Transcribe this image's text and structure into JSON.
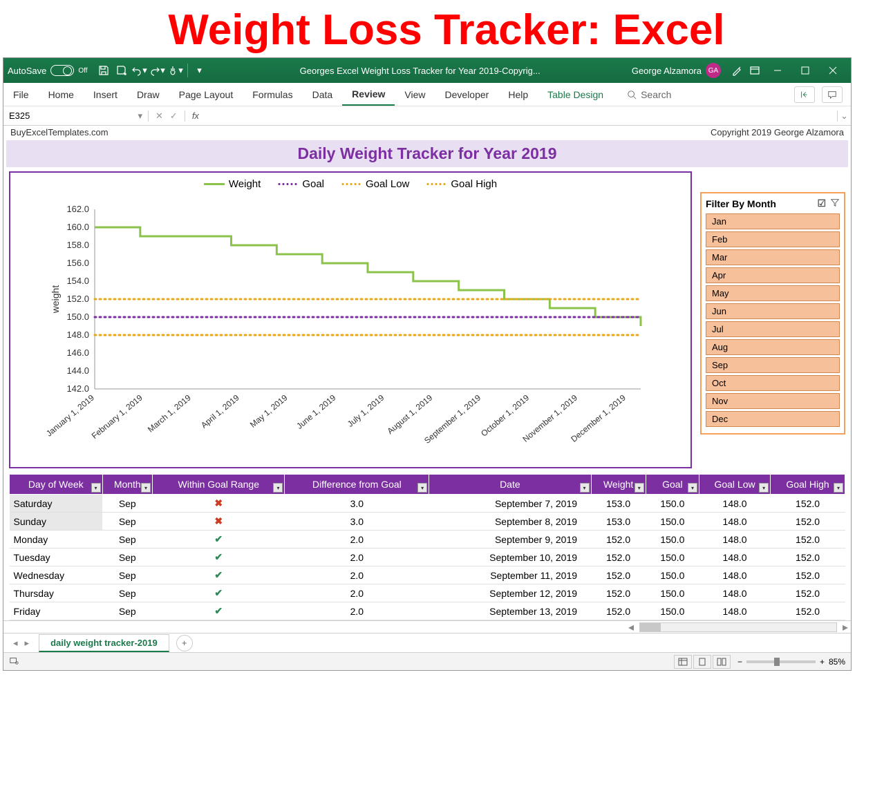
{
  "overlay_title": "Weight Loss Tracker: Excel",
  "titlebar": {
    "autosave_label": "AutoSave",
    "autosave_state": "Off",
    "doc_title": "Georges Excel Weight Loss Tracker for Year 2019-Copyrig...",
    "user": "George Alzamora",
    "avatar": "GA"
  },
  "ribbon": {
    "tabs": [
      "File",
      "Home",
      "Insert",
      "Draw",
      "Page Layout",
      "Formulas",
      "Data",
      "Review",
      "View",
      "Developer",
      "Help",
      "Table Design"
    ],
    "active": "Review",
    "search_label": "Search"
  },
  "formula_bar": {
    "name_box": "E325",
    "fx": "fx"
  },
  "sheet_header": {
    "left": "BuyExcelTemplates.com",
    "right": "Copyright 2019  George Alzamora"
  },
  "tracker_title": "Daily Weight Tracker for Year 2019",
  "legend": {
    "weight": "Weight",
    "goal": "Goal",
    "goal_low": "Goal Low",
    "goal_high": "Goal High"
  },
  "slicer": {
    "title": "Filter By Month",
    "items": [
      "Jan",
      "Feb",
      "Mar",
      "Apr",
      "May",
      "Jun",
      "Jul",
      "Aug",
      "Sep",
      "Oct",
      "Nov",
      "Dec"
    ]
  },
  "table": {
    "headers": [
      "Day of Week",
      "Month",
      "Within Goal Range",
      "Difference from Goal",
      "Date",
      "Weight",
      "Goal",
      "Goal Low",
      "Goal High"
    ],
    "rows": [
      {
        "dow": "Saturday",
        "month": "Sep",
        "within": false,
        "diff": "3.0",
        "date": "September 7, 2019",
        "weight": "153.0",
        "goal": "150.0",
        "low": "148.0",
        "high": "152.0"
      },
      {
        "dow": "Sunday",
        "month": "Sep",
        "within": false,
        "diff": "3.0",
        "date": "September 8, 2019",
        "weight": "153.0",
        "goal": "150.0",
        "low": "148.0",
        "high": "152.0"
      },
      {
        "dow": "Monday",
        "month": "Sep",
        "within": true,
        "diff": "2.0",
        "date": "September 9, 2019",
        "weight": "152.0",
        "goal": "150.0",
        "low": "148.0",
        "high": "152.0"
      },
      {
        "dow": "Tuesday",
        "month": "Sep",
        "within": true,
        "diff": "2.0",
        "date": "September 10, 2019",
        "weight": "152.0",
        "goal": "150.0",
        "low": "148.0",
        "high": "152.0"
      },
      {
        "dow": "Wednesday",
        "month": "Sep",
        "within": true,
        "diff": "2.0",
        "date": "September 11, 2019",
        "weight": "152.0",
        "goal": "150.0",
        "low": "148.0",
        "high": "152.0"
      },
      {
        "dow": "Thursday",
        "month": "Sep",
        "within": true,
        "diff": "2.0",
        "date": "September 12, 2019",
        "weight": "152.0",
        "goal": "150.0",
        "low": "148.0",
        "high": "152.0"
      },
      {
        "dow": "Friday",
        "month": "Sep",
        "within": true,
        "diff": "2.0",
        "date": "September 13, 2019",
        "weight": "152.0",
        "goal": "150.0",
        "low": "148.0",
        "high": "152.0"
      }
    ]
  },
  "sheet_tabs": {
    "active": "daily weight tracker-2019"
  },
  "status": {
    "zoom": "85%"
  },
  "chart_data": {
    "type": "line",
    "title": "Daily Weight Tracker for Year 2019",
    "ylabel": "weight",
    "ylim": [
      142,
      162
    ],
    "yticks": [
      142.0,
      144.0,
      146.0,
      148.0,
      150.0,
      152.0,
      154.0,
      156.0,
      158.0,
      160.0,
      162.0
    ],
    "x_categories": [
      "January 1, 2019",
      "February 1, 2019",
      "March 1, 2019",
      "April 1, 2019",
      "May 1, 2019",
      "June 1, 2019",
      "July 1, 2019",
      "August 1, 2019",
      "September 1, 2019",
      "October 1, 2019",
      "November 1, 2019",
      "December 1, 2019"
    ],
    "series": [
      {
        "name": "Weight",
        "style": "solid",
        "color": "#8bc34a",
        "values": [
          160,
          159,
          159,
          158,
          157,
          156,
          155,
          154,
          153,
          152,
          151,
          150,
          149
        ]
      },
      {
        "name": "Goal",
        "style": "dotted",
        "color": "#7b2fa0",
        "values": [
          150,
          150,
          150,
          150,
          150,
          150,
          150,
          150,
          150,
          150,
          150,
          150,
          150
        ]
      },
      {
        "name": "Goal Low",
        "style": "dotted",
        "color": "#e6a817",
        "values": [
          148,
          148,
          148,
          148,
          148,
          148,
          148,
          148,
          148,
          148,
          148,
          148,
          148
        ]
      },
      {
        "name": "Goal High",
        "style": "dotted",
        "color": "#e6a817",
        "values": [
          152,
          152,
          152,
          152,
          152,
          152,
          152,
          152,
          152,
          152,
          152,
          152,
          152
        ]
      }
    ]
  }
}
